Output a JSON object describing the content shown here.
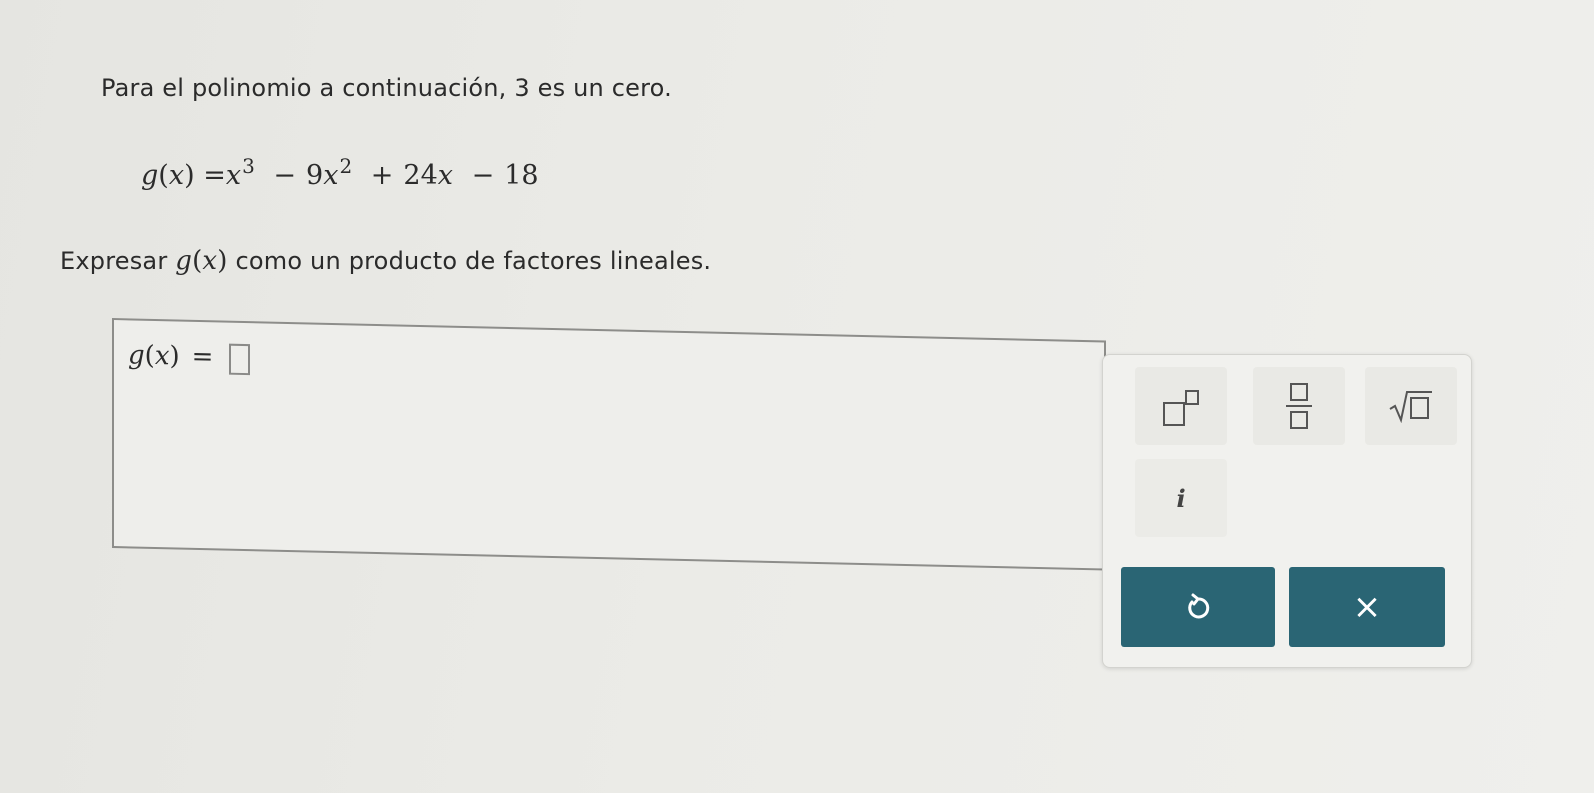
{
  "problem": {
    "intro": "Para el polinomio a continuación, 3 es un cero.",
    "polynomial": {
      "lhs_fn": "g",
      "lhs_var": "x",
      "eq": "=",
      "t1_base": "x",
      "t1_exp": "3",
      "op1": "−",
      "t2_coef": "9",
      "t2_base": "x",
      "t2_exp": "2",
      "op2": "+",
      "t3_coef": "24",
      "t3_var": "x",
      "op3": "−",
      "t4": "18"
    },
    "instruction_before": "Expresar",
    "instruction_fn": "g",
    "instruction_var": "x",
    "instruction_after": "como un producto de factores lineales."
  },
  "answer": {
    "fn": "g",
    "var": "x",
    "eq": "="
  },
  "palette": {
    "buttons": [
      {
        "name": "superscript-template",
        "icon": "superscript-icon"
      },
      {
        "name": "fraction-template",
        "icon": "fraction-icon"
      },
      {
        "name": "square-root-template",
        "icon": "square-root-icon"
      },
      {
        "name": "imaginary-unit",
        "label": "i"
      }
    ],
    "imaginary_label": "i",
    "undo_icon": "undo-icon",
    "clear_icon": "close-icon",
    "clear_glyph": "×",
    "accent_color": "#2a6574"
  }
}
